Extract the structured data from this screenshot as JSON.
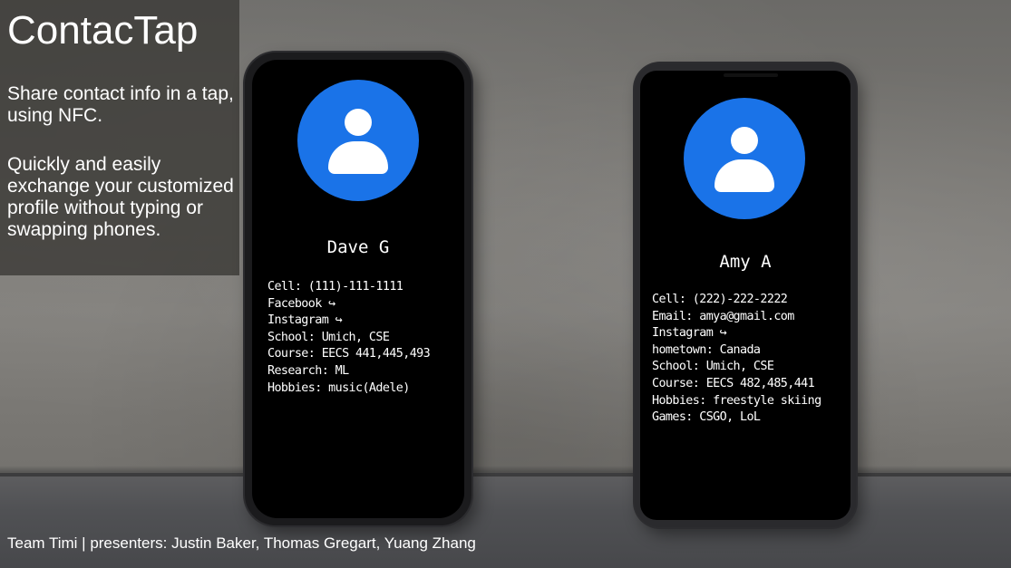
{
  "slide": {
    "title": "ContacTap",
    "tagline": "Share contact info in a tap, using NFC.",
    "description": "Quickly and easily exchange your customized profile without typing or swapping phones.",
    "footer": "Team Timi | presenters: Justin Baker, Thomas Gregart, Yuang Zhang"
  },
  "colors": {
    "avatar": "#1a73e8",
    "screen": "#000000"
  },
  "phones": [
    {
      "name": "Dave G",
      "avatar_icon": "person-icon",
      "fields": [
        "Cell: (111)-111-1111",
        "Facebook ↪",
        "Instagram ↪",
        "School: Umich, CSE",
        "Course: EECS 441,445,493",
        "Research: ML",
        "Hobbies: music(Adele)"
      ]
    },
    {
      "name": "Amy A",
      "avatar_icon": "person-icon",
      "fields": [
        "Cell: (222)-222-2222",
        "Email: amya@gmail.com",
        "Instagram ↪",
        "hometown: Canada",
        "School: Umich, CSE",
        "Course: EECS 482,485,441",
        "Hobbies: freestyle skiing",
        "Games: CSGO, LoL"
      ]
    }
  ]
}
